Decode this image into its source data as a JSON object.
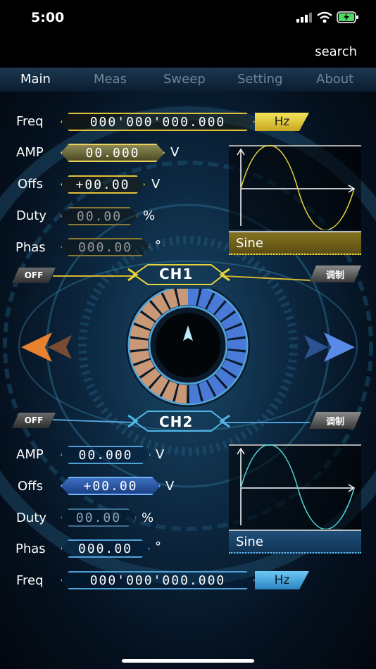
{
  "status": {
    "time": "5:00"
  },
  "header": {
    "search_label": "search"
  },
  "tabs": [
    {
      "label": "Main",
      "active": true
    },
    {
      "label": "Meas",
      "active": false
    },
    {
      "label": "Sweep",
      "active": false
    },
    {
      "label": "Setting",
      "active": false
    },
    {
      "label": "About",
      "active": false
    }
  ],
  "ch1": {
    "label": "CH1",
    "off_label": "OFF",
    "mod_label": "调制",
    "freq": {
      "label": "Freq",
      "value": "000'000'000.000",
      "unit": "Hz"
    },
    "amp": {
      "label": "AMP",
      "value": "00.000",
      "unit": "V"
    },
    "offs": {
      "label": "Offs",
      "value": "+00.00",
      "unit": "V"
    },
    "duty": {
      "label": "Duty",
      "value": "00.00",
      "unit": "%"
    },
    "phas": {
      "label": "Phas",
      "value": "000.00",
      "unit": "°"
    },
    "waveform": "Sine",
    "color": "#e6d23a"
  },
  "ch2": {
    "label": "CH2",
    "off_label": "OFF",
    "mod_label": "调制",
    "amp": {
      "label": "AMP",
      "value": "00.000",
      "unit": "V"
    },
    "offs": {
      "label": "Offs",
      "value": "+00.00",
      "unit": "V"
    },
    "duty": {
      "label": "Duty",
      "value": "00.00",
      "unit": "%"
    },
    "phas": {
      "label": "Phas",
      "value": "000.00",
      "unit": "°"
    },
    "freq": {
      "label": "Freq",
      "value": "000'000'000.000",
      "unit": "Hz"
    },
    "waveform": "Sine",
    "color": "#4fb6e6"
  },
  "icons": {
    "left": "left-arrow-icon",
    "right": "right-arrow-icon",
    "dial": "rotary-knob-icon",
    "signal": "cell-signal-icon",
    "wifi": "wifi-icon",
    "battery": "battery-charging-icon"
  }
}
